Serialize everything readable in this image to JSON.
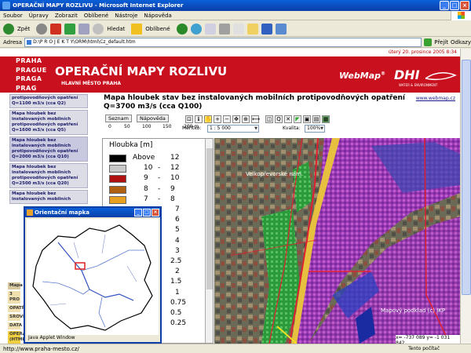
{
  "window": {
    "title": "OPERAČNÍ MAPY ROZLIVU - Microsoft Internet Explorer",
    "min_label": "_",
    "max_label": "□",
    "close_label": "×"
  },
  "menu": [
    "Soubor",
    "Úpravy",
    "Zobrazit",
    "Oblíbené",
    "Nástroje",
    "Nápověda"
  ],
  "toolbar": {
    "back_label": "Zpět",
    "search_label": "Hledat",
    "favorites_label": "Oblíbené"
  },
  "address": {
    "label": "Adresa",
    "value": "D:\\P R O J E K T Y\\ORM\\html\\Cz_default.htm",
    "go_label": "Přejít",
    "links_label": "Odkazy"
  },
  "page": {
    "date": "úterý 20. prosince 2005 8:34",
    "logo_lines": [
      "PRAHA",
      "PRAGUE",
      "PRAGA",
      "PRAG"
    ],
    "title": "OPERAČNÍ MAPY ROZLIVU",
    "subtitle": "HLAVNÍ MĚSTO PRAHA",
    "webmap": "WebMap",
    "webmap_reg": "®",
    "dhi": "DHI",
    "dhi_sub": "WATER & ENVIRONMENT",
    "map_title": "Mapa hloubek stav bez instalovaných mobilních protipovodňových opatření Q=3700 m3/s (cca Q100)",
    "www": "www.webmap.cz"
  },
  "sidebar": {
    "items": [
      "protipovodňových opatření Q=1100 m3/s (cca Q2)",
      "Mapa hloubek bez instalovaných mobilních protipovodňových opatření Q=1600 m3/s (cca Q5)",
      "Mapa hloubek bez instalovaných mobilních protipovodňových opatření Q=2000 m3/s (cca Q10)",
      "Mapa hloubek bez instalovaných mobilních protipovodňových opatření Q=2500 m3/s (cca Q20)",
      "Mapa hloubek bez instalovaných mobilních"
    ],
    "red_items": [
      "Mapa",
      "3 PRO",
      "OPATŘ",
      "SROVN",
      "DATA",
      "OPERA (HTML"
    ]
  },
  "tools": {
    "seznam": "Seznam",
    "napoveda": "Nápověda",
    "scale_labels": [
      "0",
      "50",
      "100",
      "150",
      "200 m"
    ],
    "meritko_label": "Měřítko:",
    "meritko_value": "1 : 5 000",
    "kvalita_label": "Kvalita:",
    "kvalita_value": "100%"
  },
  "legend": {
    "title": "Hloubka [m]",
    "rows": [
      {
        "a": "Above",
        "b": "12",
        "color": "#000000"
      },
      {
        "a": "10",
        "b": "12",
        "color": "#c8c8c8"
      },
      {
        "a": "9",
        "b": "10",
        "color": "#b01010"
      },
      {
        "a": "8",
        "b": "9",
        "color": "#b06010"
      },
      {
        "a": "7",
        "b": "8",
        "color": "#e8a020"
      },
      {
        "a": "",
        "b": "7",
        "color": ""
      },
      {
        "a": "",
        "b": "6",
        "color": ""
      },
      {
        "a": "",
        "b": "5",
        "color": ""
      },
      {
        "a": "",
        "b": "4",
        "color": ""
      },
      {
        "a": "",
        "b": "3",
        "color": ""
      },
      {
        "a": "",
        "b": "2.5",
        "color": ""
      },
      {
        "a": "",
        "b": "2",
        "color": ""
      },
      {
        "a": "",
        "b": "1.5",
        "color": ""
      },
      {
        "a": "",
        "b": "1",
        "color": ""
      },
      {
        "a": "",
        "b": "0.75",
        "color": ""
      },
      {
        "a": "",
        "b": "0.5",
        "color": ""
      },
      {
        "a": "",
        "b": "0.25",
        "color": ""
      }
    ]
  },
  "map": {
    "street_label": "Velkopřevorské nám.",
    "copyright": "Mapový podklad (c) IKP",
    "coords": "x= -737 089  y= -1 031 842"
  },
  "orient": {
    "title": "Orientační mapka",
    "footer": "Java Applet Window"
  },
  "status": {
    "url": "http://www.praha-mesto.cz/",
    "zone": "Tento počítač"
  }
}
